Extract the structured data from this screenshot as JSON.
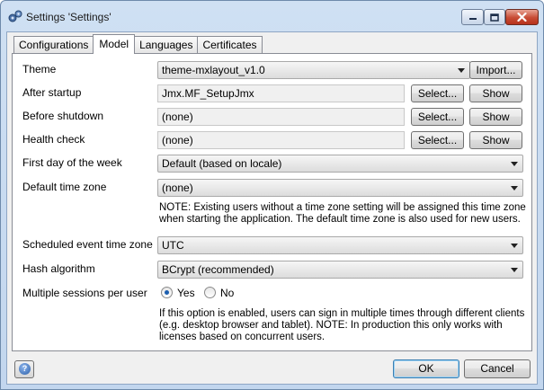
{
  "window": {
    "title": "Settings 'Settings'"
  },
  "tabs": [
    {
      "label": "Configurations",
      "active": false
    },
    {
      "label": "Model",
      "active": true
    },
    {
      "label": "Languages",
      "active": false
    },
    {
      "label": "Certificates",
      "active": false
    }
  ],
  "fields": {
    "theme": {
      "label": "Theme",
      "value": "theme-mxlayout_v1.0",
      "import_label": "Import..."
    },
    "after_startup": {
      "label": "After startup",
      "value": "Jmx.MF_SetupJmx",
      "select_label": "Select...",
      "show_label": "Show"
    },
    "before_shutdown": {
      "label": "Before shutdown",
      "value": "(none)",
      "select_label": "Select...",
      "show_label": "Show"
    },
    "health_check": {
      "label": "Health check",
      "value": "(none)",
      "select_label": "Select...",
      "show_label": "Show"
    },
    "first_day": {
      "label": "First day of the week",
      "value": "Default (based on locale)"
    },
    "default_tz": {
      "label": "Default time zone",
      "value": "(none)",
      "note_line1": "NOTE: Existing users without a time zone setting will be assigned this time zone",
      "note_line2": "when starting the application. The default time zone is also used for new users."
    },
    "scheduled_tz": {
      "label": "Scheduled event time zone",
      "value": "UTC"
    },
    "hash": {
      "label": "Hash algorithm",
      "value": "BCrypt (recommended)"
    },
    "multi_sessions": {
      "label": "Multiple sessions per user",
      "yes_label": "Yes",
      "no_label": "No",
      "selected": "Yes",
      "note_line1": "If this option is enabled, users can sign in multiple times through different clients",
      "note_line2": "(e.g. desktop browser and tablet). NOTE: In production this only works with",
      "note_line3": "licenses based on concurrent users."
    }
  },
  "footer": {
    "ok_label": "OK",
    "cancel_label": "Cancel"
  },
  "icons": [
    "settings-gear-icon",
    "minimize-icon",
    "maximize-icon",
    "close-icon",
    "help-icon",
    "dropdown-arrow-icon"
  ],
  "colors": {
    "close_red": "#c74b34",
    "radio_dot": "#1d5fb0",
    "title_bar": "#cfe0f3"
  }
}
